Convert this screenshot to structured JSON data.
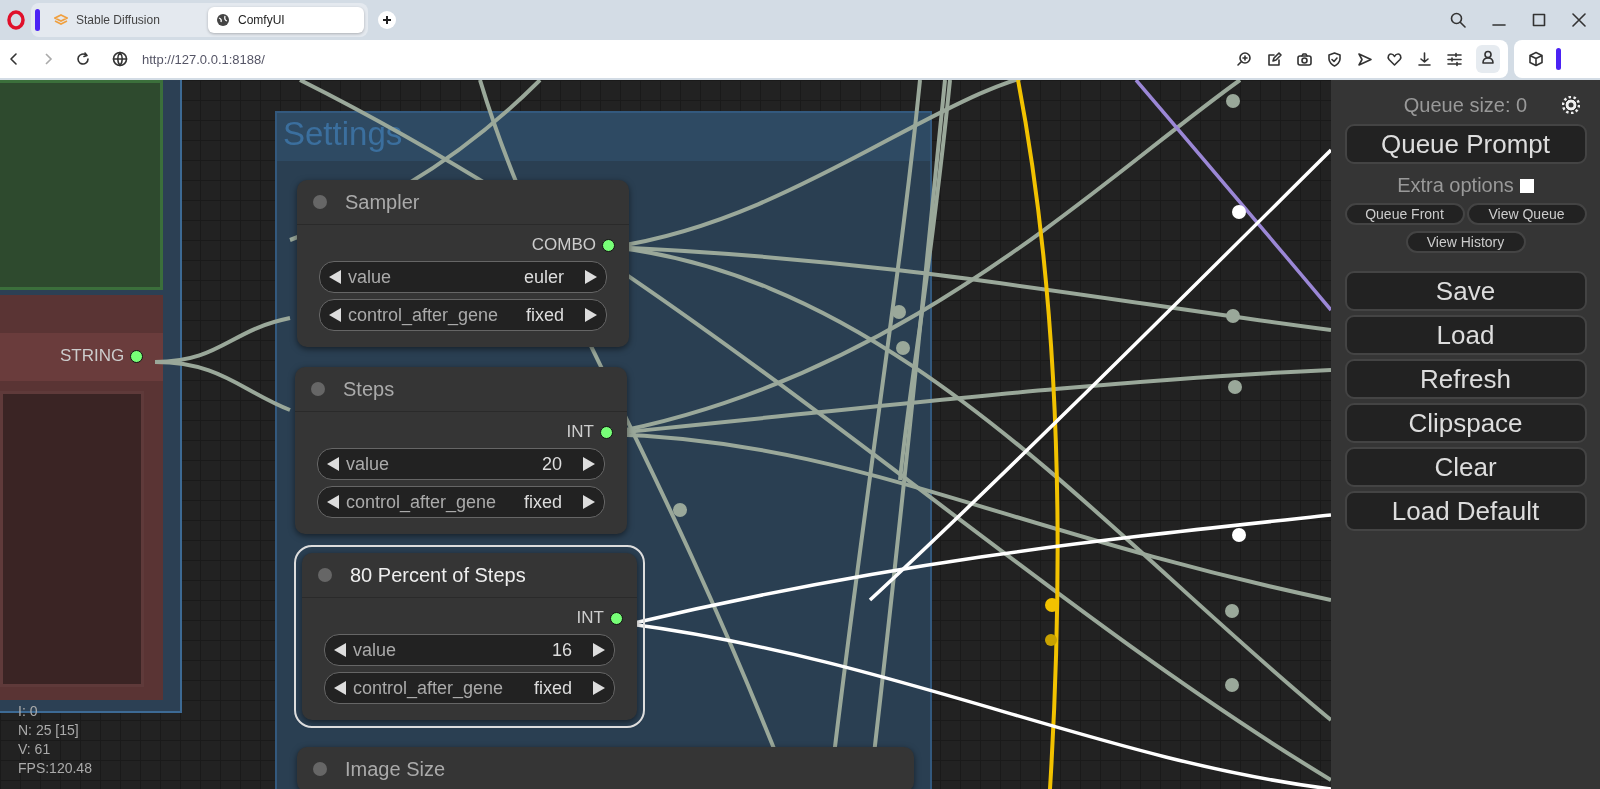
{
  "browser": {
    "tabs": [
      {
        "title": "Stable Diffusion",
        "selected": false
      },
      {
        "title": "ComfyUI",
        "selected": true
      }
    ],
    "address": "http://127.0.0.1:8188/"
  },
  "canvas": {
    "group": {
      "title": "Settings"
    },
    "string_output": {
      "type": "STRING"
    },
    "nodes": [
      {
        "title": "Sampler",
        "selected": false,
        "output": "COMBO",
        "widgets": [
          {
            "label": "value",
            "value": "euler"
          },
          {
            "label": "control_after_gene",
            "value": "fixed"
          }
        ]
      },
      {
        "title": "Steps",
        "selected": false,
        "output": "INT",
        "widgets": [
          {
            "label": "value",
            "value": "20"
          },
          {
            "label": "control_after_gene",
            "value": "fixed"
          }
        ]
      },
      {
        "title": "80 Percent of Steps",
        "selected": true,
        "output": "INT",
        "widgets": [
          {
            "label": "value",
            "value": "16"
          },
          {
            "label": "control_after_gene",
            "value": "fixed"
          }
        ]
      },
      {
        "title": "Image Size",
        "selected": false
      }
    ],
    "stats": [
      "I: 0",
      "N: 25 [15]",
      "V: 61",
      "FPS:120.48"
    ]
  },
  "panel": {
    "queue_size": "Queue size: 0",
    "queue_button": "Queue Prompt",
    "extra_options": {
      "label": "Extra options",
      "checked": false
    },
    "small_buttons": [
      "Queue Front",
      "View Queue",
      "View History"
    ],
    "buttons": [
      "Save",
      "Load",
      "Refresh",
      "Clipspace",
      "Clear",
      "Load Default"
    ]
  }
}
